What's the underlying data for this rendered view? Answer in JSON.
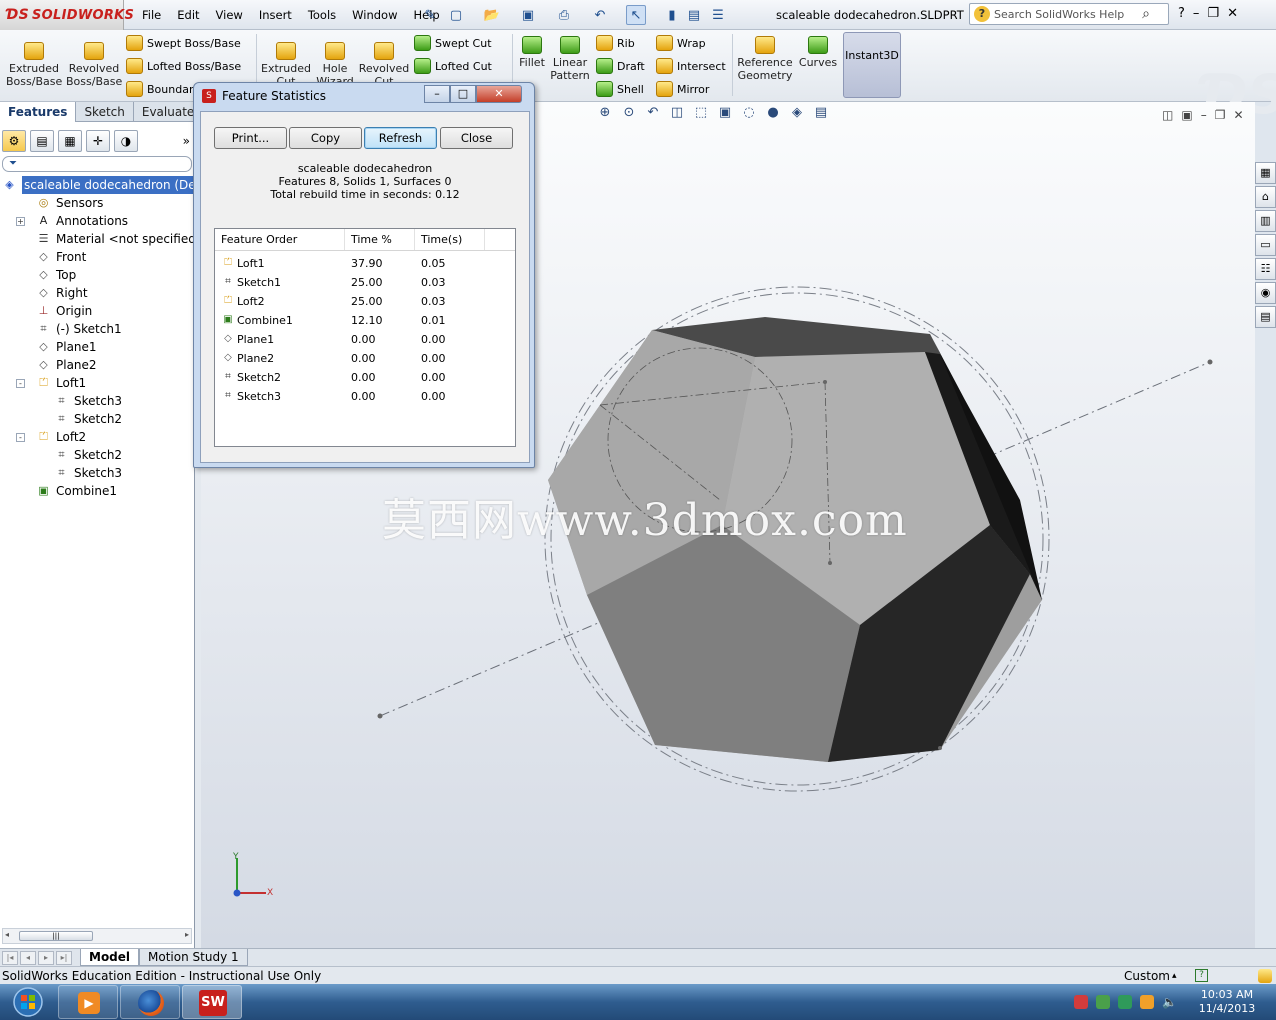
{
  "app": {
    "brand": "SOLIDWORKS",
    "doc_title": "scaleable dodecahedron.SLDPRT"
  },
  "menu": [
    "File",
    "Edit",
    "View",
    "Insert",
    "Tools",
    "Window",
    "Help"
  ],
  "search": {
    "placeholder": "Search SolidWorks Help"
  },
  "ribbon": {
    "extruded_boss": "Extruded Boss/Base",
    "revolved_boss": "Revolved Boss/Base",
    "swept_boss": "Swept Boss/Base",
    "lofted_boss": "Lofted Boss/Base",
    "boundary": "Boundary",
    "extruded_cut": "Extruded Cut",
    "hole_wizard": "Hole Wizard",
    "revolved_cut": "Revolved Cut",
    "swept_cut": "Swept Cut",
    "lofted_cut": "Lofted Cut",
    "fillet": "Fillet",
    "linear_pattern": "Linear Pattern",
    "rib": "Rib",
    "draft": "Draft",
    "shell": "Shell",
    "wrap": "Wrap",
    "intersect": "Intersect",
    "mirror": "Mirror",
    "reference_geometry": "Reference Geometry",
    "curves": "Curves",
    "instant3d": "Instant3D"
  },
  "cm_tabs": [
    "Features",
    "Sketch",
    "Evaluate"
  ],
  "tree": [
    {
      "label": "scaleable dodecahedron  (Default",
      "icon": "part-icon",
      "indent": 0,
      "selected": true
    },
    {
      "label": "Sensors",
      "icon": "sensor-icon",
      "indent": 1
    },
    {
      "label": "Annotations",
      "icon": "annotation-icon",
      "indent": 1,
      "expander": "+"
    },
    {
      "label": "Material <not specified>",
      "icon": "material-icon",
      "indent": 1
    },
    {
      "label": "Front",
      "icon": "plane-icon",
      "indent": 1
    },
    {
      "label": "Top",
      "icon": "plane-icon",
      "indent": 1
    },
    {
      "label": "Right",
      "icon": "plane-icon",
      "indent": 1
    },
    {
      "label": "Origin",
      "icon": "origin-icon",
      "indent": 1
    },
    {
      "label": "(-) Sketch1",
      "icon": "sketch-icon",
      "indent": 1
    },
    {
      "label": "Plane1",
      "icon": "plane-icon",
      "indent": 1
    },
    {
      "label": "Plane2",
      "icon": "plane-icon",
      "indent": 1
    },
    {
      "label": "Loft1",
      "icon": "loft-icon",
      "indent": 1,
      "expander": "-"
    },
    {
      "label": "Sketch3",
      "icon": "sketch-icon",
      "indent": 2
    },
    {
      "label": "Sketch2",
      "icon": "sketch-icon",
      "indent": 2
    },
    {
      "label": "Loft2",
      "icon": "loft-icon",
      "indent": 1,
      "expander": "-"
    },
    {
      "label": "Sketch2",
      "icon": "sketch-icon",
      "indent": 2
    },
    {
      "label": "Sketch3",
      "icon": "sketch-icon",
      "indent": 2
    },
    {
      "label": "Combine1",
      "icon": "combine-icon",
      "indent": 1
    }
  ],
  "dialog": {
    "title": "Feature Statistics",
    "buttons": [
      "Print...",
      "Copy",
      "Refresh",
      "Close"
    ],
    "part_name": "scaleable dodecahedron",
    "summary": "Features 8, Solids 1, Surfaces 0",
    "rebuild": "Total rebuild time in seconds: 0.12",
    "columns": [
      "Feature Order",
      "Time %",
      "Time(s)"
    ],
    "rows": [
      {
        "name": "Loft1",
        "pct": "37.90",
        "time": "0.05",
        "icon": "loft-icon"
      },
      {
        "name": "Sketch1",
        "pct": "25.00",
        "time": "0.03",
        "icon": "sketch-icon"
      },
      {
        "name": "Loft2",
        "pct": "25.00",
        "time": "0.03",
        "icon": "loft-icon"
      },
      {
        "name": "Combine1",
        "pct": "12.10",
        "time": "0.01",
        "icon": "combine-icon"
      },
      {
        "name": "Plane1",
        "pct": "0.00",
        "time": "0.00",
        "icon": "plane-icon"
      },
      {
        "name": "Plane2",
        "pct": "0.00",
        "time": "0.00",
        "icon": "plane-icon"
      },
      {
        "name": "Sketch2",
        "pct": "0.00",
        "time": "0.00",
        "icon": "sketch-icon"
      },
      {
        "name": "Sketch3",
        "pct": "0.00",
        "time": "0.00",
        "icon": "sketch-icon"
      }
    ]
  },
  "watermark": "莫西网www.3dmox.com",
  "triad": {
    "x": "X",
    "y": "Y"
  },
  "bottom_tabs": [
    "Model",
    "Motion Study 1"
  ],
  "status": {
    "left": "SolidWorks Education Edition - Instructional Use Only",
    "units": "Custom"
  },
  "taskbar": {
    "time": "10:03 AM",
    "date": "11/4/2013",
    "apps": [
      "media-player-icon",
      "firefox-icon",
      "solidworks-icon"
    ]
  }
}
